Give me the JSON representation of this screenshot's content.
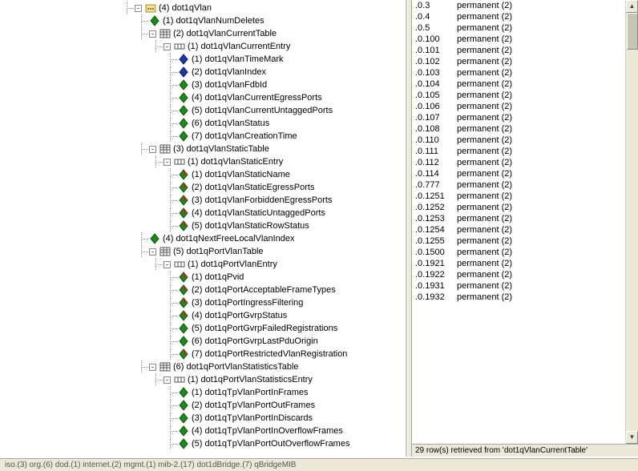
{
  "tree": [
    {
      "depth": 0,
      "expander": "-",
      "icon": "folder-dots",
      "label": "(4) dot1qVlan"
    },
    {
      "depth": 1,
      "expander": "",
      "icon": "leaf-green",
      "label": "(1) dot1qVlanNumDeletes"
    },
    {
      "depth": 1,
      "expander": "-",
      "icon": "table",
      "label": "(2) dot1qVlanCurrentTable"
    },
    {
      "depth": 2,
      "expander": "-",
      "icon": "entry",
      "label": "(1) dot1qVlanCurrentEntry"
    },
    {
      "depth": 3,
      "expander": "",
      "icon": "leaf-blue",
      "label": "(1) dot1qVlanTimeMark"
    },
    {
      "depth": 3,
      "expander": "",
      "icon": "leaf-blue",
      "label": "(2) dot1qVlanIndex"
    },
    {
      "depth": 3,
      "expander": "",
      "icon": "leaf-green",
      "label": "(3) dot1qVlanFdbId"
    },
    {
      "depth": 3,
      "expander": "",
      "icon": "leaf-green",
      "label": "(4) dot1qVlanCurrentEgressPorts"
    },
    {
      "depth": 3,
      "expander": "",
      "icon": "leaf-green",
      "label": "(5) dot1qVlanCurrentUntaggedPorts"
    },
    {
      "depth": 3,
      "expander": "",
      "icon": "leaf-green",
      "label": "(6) dot1qVlanStatus"
    },
    {
      "depth": 3,
      "expander": "",
      "icon": "leaf-green",
      "label": "(7) dot1qVlanCreationTime"
    },
    {
      "depth": 1,
      "expander": "-",
      "icon": "table",
      "label": "(3) dot1qVlanStaticTable"
    },
    {
      "depth": 2,
      "expander": "-",
      "icon": "entry",
      "label": "(1) dot1qVlanStaticEntry"
    },
    {
      "depth": 3,
      "expander": "",
      "icon": "leaf-rw",
      "label": "(1) dot1qVlanStaticName"
    },
    {
      "depth": 3,
      "expander": "",
      "icon": "leaf-rw",
      "label": "(2) dot1qVlanStaticEgressPorts"
    },
    {
      "depth": 3,
      "expander": "",
      "icon": "leaf-rw",
      "label": "(3) dot1qVlanForbiddenEgressPorts"
    },
    {
      "depth": 3,
      "expander": "",
      "icon": "leaf-rw",
      "label": "(4) dot1qVlanStaticUntaggedPorts"
    },
    {
      "depth": 3,
      "expander": "",
      "icon": "leaf-rw",
      "label": "(5) dot1qVlanStaticRowStatus"
    },
    {
      "depth": 1,
      "expander": "",
      "icon": "leaf-green",
      "label": "(4) dot1qNextFreeLocalVlanIndex"
    },
    {
      "depth": 1,
      "expander": "-",
      "icon": "table",
      "label": "(5) dot1qPortVlanTable"
    },
    {
      "depth": 2,
      "expander": "-",
      "icon": "entry",
      "label": "(1) dot1qPortVlanEntry"
    },
    {
      "depth": 3,
      "expander": "",
      "icon": "leaf-rw",
      "label": "(1) dot1qPvid"
    },
    {
      "depth": 3,
      "expander": "",
      "icon": "leaf-rw",
      "label": "(2) dot1qPortAcceptableFrameTypes"
    },
    {
      "depth": 3,
      "expander": "",
      "icon": "leaf-rw",
      "label": "(3) dot1qPortIngressFiltering"
    },
    {
      "depth": 3,
      "expander": "",
      "icon": "leaf-rw",
      "label": "(4) dot1qPortGvrpStatus"
    },
    {
      "depth": 3,
      "expander": "",
      "icon": "leaf-green",
      "label": "(5) dot1qPortGvrpFailedRegistrations"
    },
    {
      "depth": 3,
      "expander": "",
      "icon": "leaf-green",
      "label": "(6) dot1qPortGvrpLastPduOrigin"
    },
    {
      "depth": 3,
      "expander": "",
      "icon": "leaf-rw",
      "label": "(7) dot1qPortRestrictedVlanRegistration"
    },
    {
      "depth": 1,
      "expander": "-",
      "icon": "table",
      "label": "(6) dot1qPortVlanStatisticsTable"
    },
    {
      "depth": 2,
      "expander": "-",
      "icon": "entry",
      "label": "(1) dot1qPortVlanStatisticsEntry"
    },
    {
      "depth": 3,
      "expander": "",
      "icon": "leaf-green",
      "label": "(1) dot1qTpVlanPortInFrames"
    },
    {
      "depth": 3,
      "expander": "",
      "icon": "leaf-green",
      "label": "(2) dot1qTpVlanPortOutFrames"
    },
    {
      "depth": 3,
      "expander": "",
      "icon": "leaf-green",
      "label": "(3) dot1qTpVlanPortInDiscards"
    },
    {
      "depth": 3,
      "expander": "",
      "icon": "leaf-green",
      "label": "(4) dot1qTpVlanPortInOverflowFrames"
    },
    {
      "depth": 3,
      "expander": "",
      "icon": "leaf-green",
      "label": "(5) dot1qTpVlanPortOutOverflowFrames"
    }
  ],
  "results": {
    "rows": [
      {
        "idx": ".0.3",
        "val": "permanent (2)"
      },
      {
        "idx": ".0.4",
        "val": "permanent (2)"
      },
      {
        "idx": ".0.5",
        "val": "permanent (2)"
      },
      {
        "idx": ".0.100",
        "val": "permanent (2)"
      },
      {
        "idx": ".0.101",
        "val": "permanent (2)"
      },
      {
        "idx": ".0.102",
        "val": "permanent (2)"
      },
      {
        "idx": ".0.103",
        "val": "permanent (2)"
      },
      {
        "idx": ".0.104",
        "val": "permanent (2)"
      },
      {
        "idx": ".0.105",
        "val": "permanent (2)"
      },
      {
        "idx": ".0.106",
        "val": "permanent (2)"
      },
      {
        "idx": ".0.107",
        "val": "permanent (2)"
      },
      {
        "idx": ".0.108",
        "val": "permanent (2)"
      },
      {
        "idx": ".0.110",
        "val": "permanent (2)"
      },
      {
        "idx": ".0.111",
        "val": "permanent (2)"
      },
      {
        "idx": ".0.112",
        "val": "permanent (2)"
      },
      {
        "idx": ".0.114",
        "val": "permanent (2)"
      },
      {
        "idx": ".0.777",
        "val": "permanent (2)"
      },
      {
        "idx": ".0.1251",
        "val": "permanent (2)"
      },
      {
        "idx": ".0.1252",
        "val": "permanent (2)"
      },
      {
        "idx": ".0.1253",
        "val": "permanent (2)"
      },
      {
        "idx": ".0.1254",
        "val": "permanent (2)"
      },
      {
        "idx": ".0.1255",
        "val": "permanent (2)"
      },
      {
        "idx": ".0.1500",
        "val": "permanent (2)"
      },
      {
        "idx": ".0.1921",
        "val": "permanent (2)"
      },
      {
        "idx": ".0.1922",
        "val": "permanent (2)"
      },
      {
        "idx": ".0.1931",
        "val": "permanent (2)"
      },
      {
        "idx": ".0.1932",
        "val": "permanent (2)"
      }
    ],
    "status": "29 row(s) retrieved from 'dot1qVlanCurrentTable'"
  },
  "breadcrumb": "iso.(3) org.(6) dod.(1) internet.(2) mgmt.(1) mib-2.(17) dot1dBridge.(7) qBridgeMIB"
}
